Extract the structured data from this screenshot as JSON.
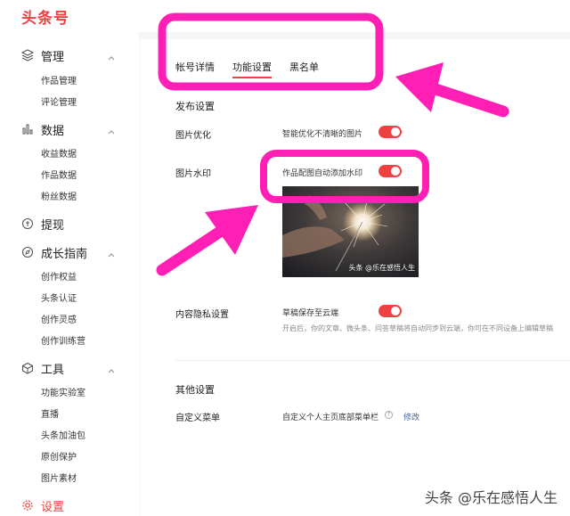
{
  "app": {
    "logo": "头条号",
    "brand_color": "#f04142"
  },
  "sidebar": {
    "groups": [
      {
        "title": "管理",
        "icon": "layers-icon",
        "items": [
          "作品管理",
          "评论管理"
        ]
      },
      {
        "title": "数据",
        "icon": "bar-chart-icon",
        "items": [
          "收益数据",
          "作品数据",
          "粉丝数据"
        ]
      },
      {
        "title": "提现",
        "icon": "coin-icon",
        "items": []
      },
      {
        "title": "成长指南",
        "icon": "compass-icon",
        "items": [
          "创作权益",
          "头条认证",
          "创作灵感",
          "创作训练营"
        ]
      },
      {
        "title": "工具",
        "icon": "cube-icon",
        "items": [
          "功能实验室",
          "直播",
          "头条加油包",
          "原创保护",
          "图片素材"
        ]
      },
      {
        "title": "设置",
        "icon": "gear-icon",
        "items": []
      }
    ]
  },
  "tabs": [
    "帐号详情",
    "功能设置",
    "黑名单"
  ],
  "active_tab": "功能设置",
  "publish": {
    "title": "发布设置",
    "image_optimize": {
      "label": "图片优化",
      "text": "智能优化不清晰的图片",
      "enabled": true
    },
    "watermark": {
      "label": "图片水印",
      "text": "作品配图自动添加水印",
      "enabled": true,
      "preview_mark": "头条 @乐在感悟人生"
    },
    "privacy": {
      "label": "内容隐私设置",
      "text": "草稿保存至云端",
      "enabled": true,
      "hint": "开启后，你的文章、微头条、问答草稿将自动同步到云端，你可在不同设备上编辑草稿"
    }
  },
  "other": {
    "title": "其他设置",
    "menu": {
      "label": "自定义菜单",
      "text": "自定义个人主页底部菜单栏",
      "help": "?",
      "link": "修改"
    }
  },
  "page_watermark": "头条 @乐在感悟人生",
  "annotation_color": "#ff1fb4"
}
